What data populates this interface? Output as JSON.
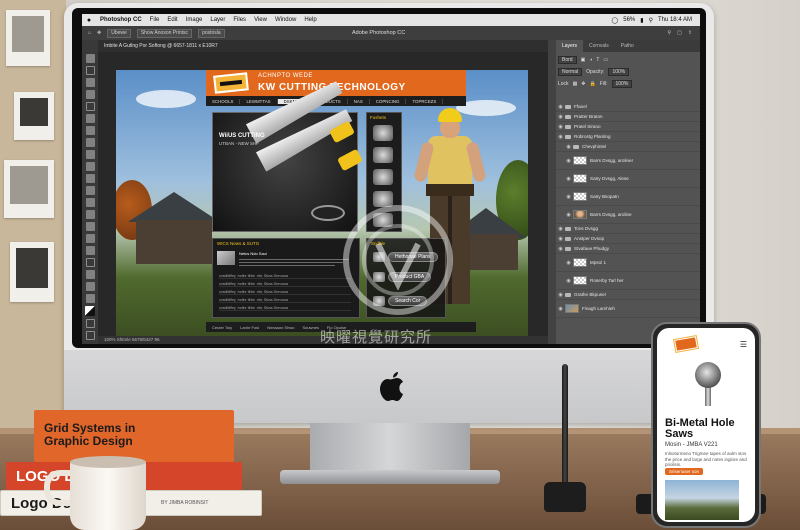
{
  "menubar": {
    "app": "Photoshop CC",
    "items": [
      "File",
      "Edit",
      "Image",
      "Layer",
      "Files",
      "View",
      "Window",
      "Help"
    ],
    "battery": "56%",
    "clock": "Thu 18:4 AM"
  },
  "optbar": {
    "title": "Adobe Photoshop CC",
    "box1": "Ubewe",
    "box2": "Show Anoson Printsc",
    "box3": "postosla"
  },
  "document": {
    "tab": "Imbite A Gutlng Por Softong @ 6657-1811 x E10R7",
    "status": "100%    Shtmle 5678/6427 96"
  },
  "panels": {
    "tabs": [
      "Layers",
      "Cornvals",
      "Patho"
    ],
    "kind": "Bord",
    "blend": "Normal",
    "opacity_label": "Opacity:",
    "opacity": "100%",
    "lock_label": "Lock",
    "fill_label": "Fill:",
    "fill": "100%",
    "layers": [
      "Ffaoel",
      "Pratter Braton",
      "Pratel Sirano",
      "Robrostg Planting",
      "Chevphintel",
      "Barrs Dvsgg, aroliner",
      "Satry Dvsgg, Alese",
      "Satry Bsopatn",
      "Barrs Dvsgg, aroline",
      "Tons Dvsgg",
      "Anstper Dvsop",
      "Stvafaue Phudgy",
      "Mpsol 1",
      "Roserby Tarl her",
      "Grathe Bkpuser",
      "Finagh Lamhieh"
    ]
  },
  "website": {
    "tagline": "ACHNPTO WEDE",
    "headline": "KW CUTTING TECHNOLOGY",
    "nav": [
      "SCHOOLS",
      "LEWMTTAS",
      "DSKNIDS",
      "PRODUCTS",
      "NAS",
      "COPNCING",
      "TOPRCEZS"
    ],
    "hero_brand": "WiiUS CUTTING",
    "hero_sub": "UTBAN - NEW SHF",
    "products_label": "Fushets",
    "news_label": "WICS News & SUTG",
    "news_feat": "Netcs Ndo Saui",
    "news_rows": [
      "ovsdfdfifey .mrtinr Ithiie .ritrr, Stuss Dervoscs",
      "ovsdfdfifey .mrtinr Ithiie .ritrr, Stuss Dervoscs",
      "ovsdfdfifey .mrtinr Ithiie .ritrr, Stuss Dervoscs",
      "ovsdfdfifey .mrtinr Ithiie .ritrr, Stuss Dervoscs",
      "ovsdfdfifey .mrtinr Ithiie .ritrr, Stuss Dervoscs"
    ],
    "search_label": "Sndble",
    "search_items": [
      "Hethonae Plans",
      "Product GBA",
      "Search Cor"
    ],
    "footer": [
      "Ceuter Toiy",
      "Lanhr Fosl",
      "Nnnaaon Shwo",
      "Souwnes",
      "Flo Opulse"
    ]
  },
  "watermark": "映曜視覺研究所",
  "books": [
    "Grid Systems in Graphic Design",
    "LOGO DE",
    "Logo Des",
    "BY JIMBA ROBINSIT"
  ],
  "phone": {
    "menu_icon": "hamburger-icon",
    "title": "Bi-Metal Hole Saws",
    "subtitle": "Mosin - JMBA V221",
    "description": "Inlsoturmeno Trigmee tapes of aulm stos the price and large and notes inglore and priolisis.",
    "cta": "Sriseriuser son"
  },
  "colors": {
    "brand_orange": "#e2681d",
    "ps_dark": "#535353",
    "helmet_yellow": "#f1cc1a"
  }
}
